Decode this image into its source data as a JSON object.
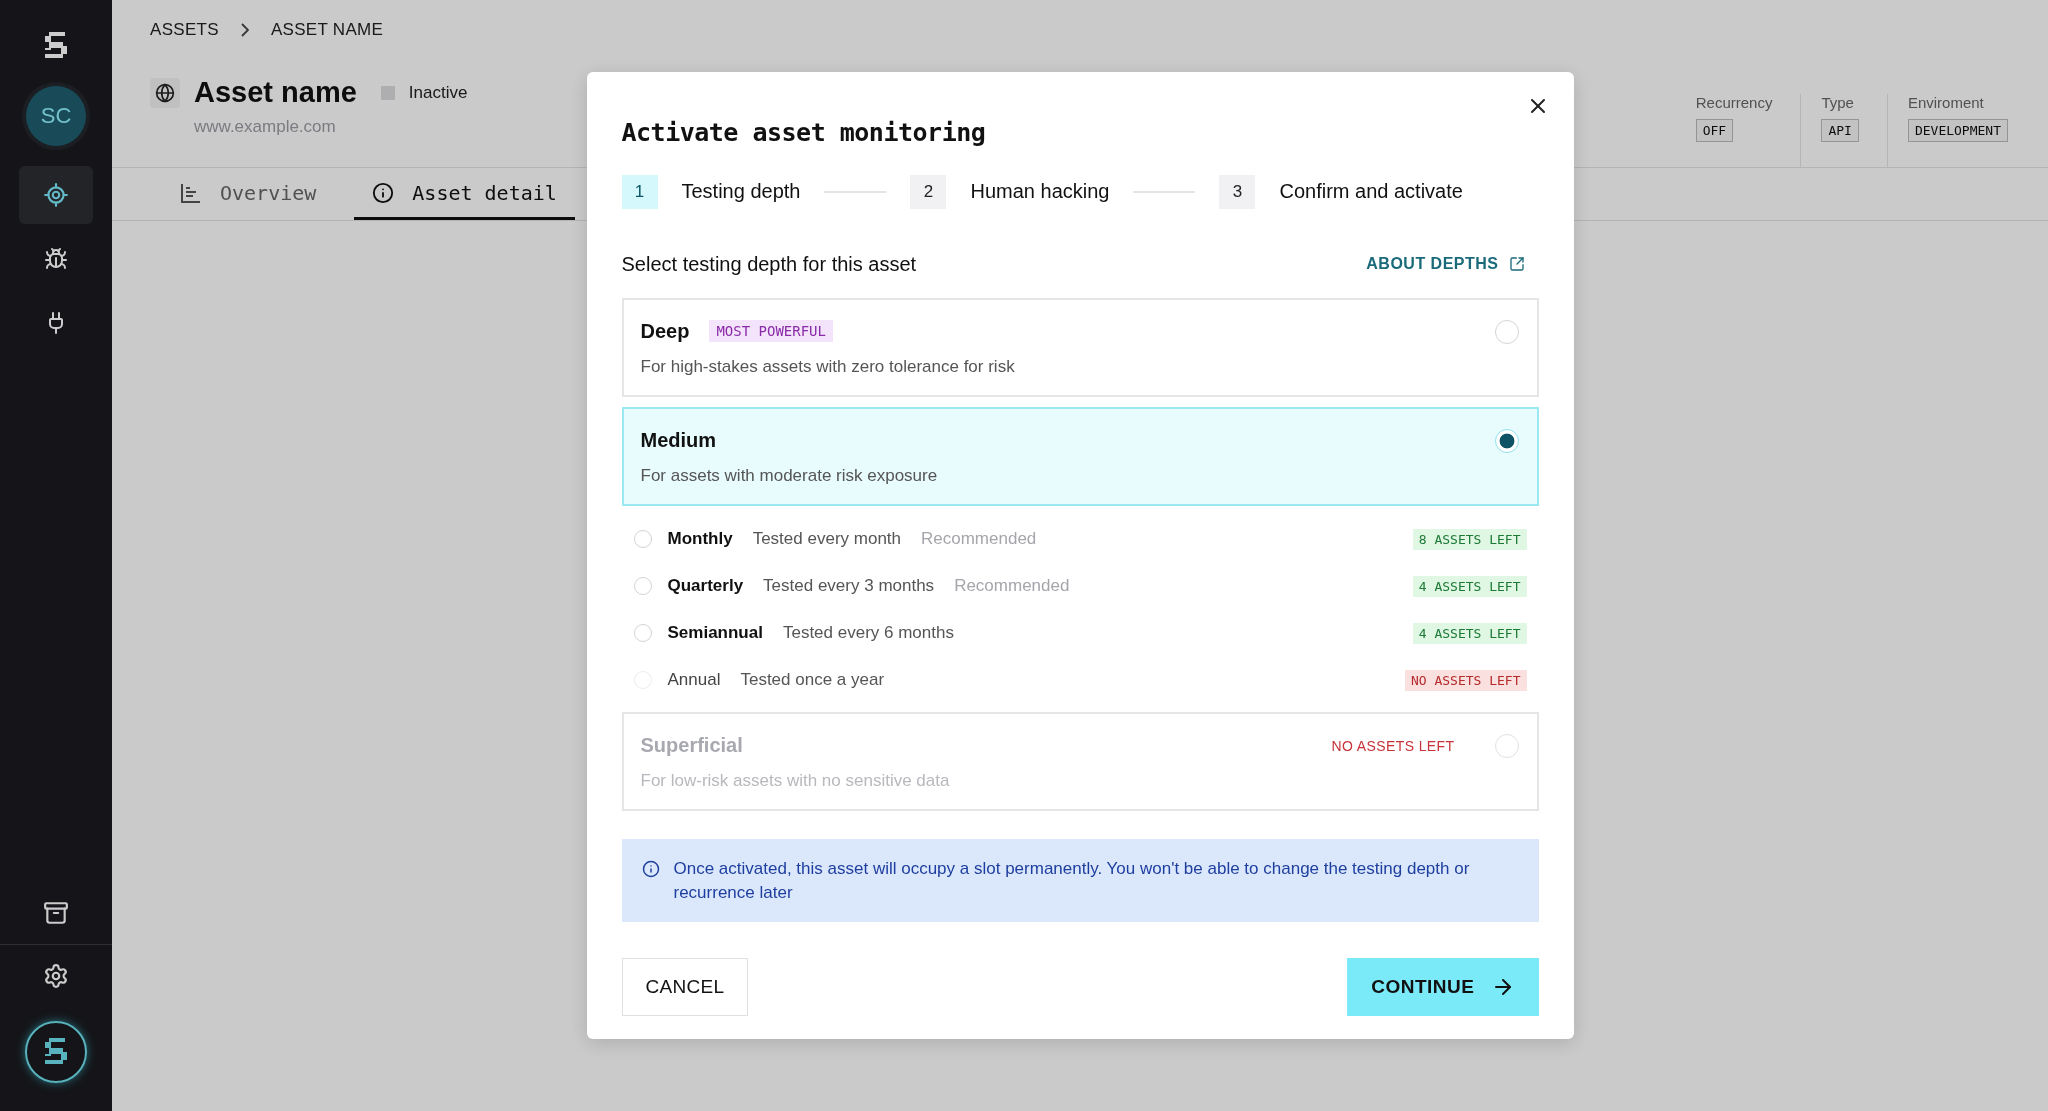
{
  "sidebar": {
    "avatar": "SC",
    "nav_items": [
      {
        "kind": "target",
        "selected": true
      },
      {
        "kind": "bug",
        "selected": false
      },
      {
        "kind": "plug",
        "selected": false
      }
    ],
    "bottom_items": [
      {
        "kind": "archive"
      },
      {
        "kind": "settings"
      }
    ]
  },
  "breadcrumb": [
    "ASSETS",
    "ASSET NAME"
  ],
  "asset": {
    "name": "Asset name",
    "status": "Inactive",
    "url": "www.example.com"
  },
  "tabs": [
    {
      "label": "Overview",
      "kind": "chart",
      "selected": false
    },
    {
      "label": "Asset detail",
      "kind": "info",
      "selected": true
    }
  ],
  "properties": [
    {
      "label": "Recurrency",
      "value": "OFF"
    },
    {
      "label": "Type",
      "value": "API"
    },
    {
      "label": "Enviroment",
      "value": "DEVELOPMENT"
    }
  ],
  "modal": {
    "title": "Activate asset monitoring",
    "steps": [
      {
        "number": "1",
        "label": "Testing depth",
        "selected": true
      },
      {
        "number": "2",
        "label": "Human hacking",
        "selected": false
      },
      {
        "number": "3",
        "label": "Confirm and activate",
        "selected": false
      }
    ],
    "prompt": "Select testing depth for this asset",
    "link": "ABOUT DEPTHS",
    "depths": [
      {
        "name": "Deep",
        "badge": "MOST POWERFUL",
        "description": "For high-stakes assets with zero tolerance for risk",
        "selected": false,
        "disabled": false
      },
      {
        "name": "Medium",
        "description": "For assets with moderate risk exposure",
        "selected": true,
        "disabled": false,
        "frequencies": [
          {
            "name": "Monthly",
            "description": "Tested every month",
            "note": "Recommended",
            "availability": "8 ASSETS LEFT",
            "kind": "available",
            "selected": false,
            "disabled": false
          },
          {
            "name": "Quarterly",
            "description": "Tested every 3 months",
            "note": "Recommended",
            "availability": "4 ASSETS LEFT",
            "kind": "available",
            "selected": false,
            "disabled": false
          },
          {
            "name": "Semiannual",
            "description": "Tested every 6 months",
            "availability": "4 ASSETS LEFT",
            "kind": "available",
            "selected": false,
            "disabled": false
          },
          {
            "name": "Annual",
            "description": "Tested once a year",
            "availability": "NO ASSETS LEFT",
            "kind": "none",
            "selected": false,
            "disabled": true
          }
        ]
      },
      {
        "name": "Superficial",
        "description": "For low-risk assets with no sensitive data",
        "availability": "NO ASSETS LEFT",
        "selected": false,
        "disabled": true
      }
    ],
    "notice": "Once activated, this asset will occupy a slot permanently. You won't be able to change the testing depth or recurrence later",
    "cancel": "CANCEL",
    "continue": "CONTINUE"
  }
}
